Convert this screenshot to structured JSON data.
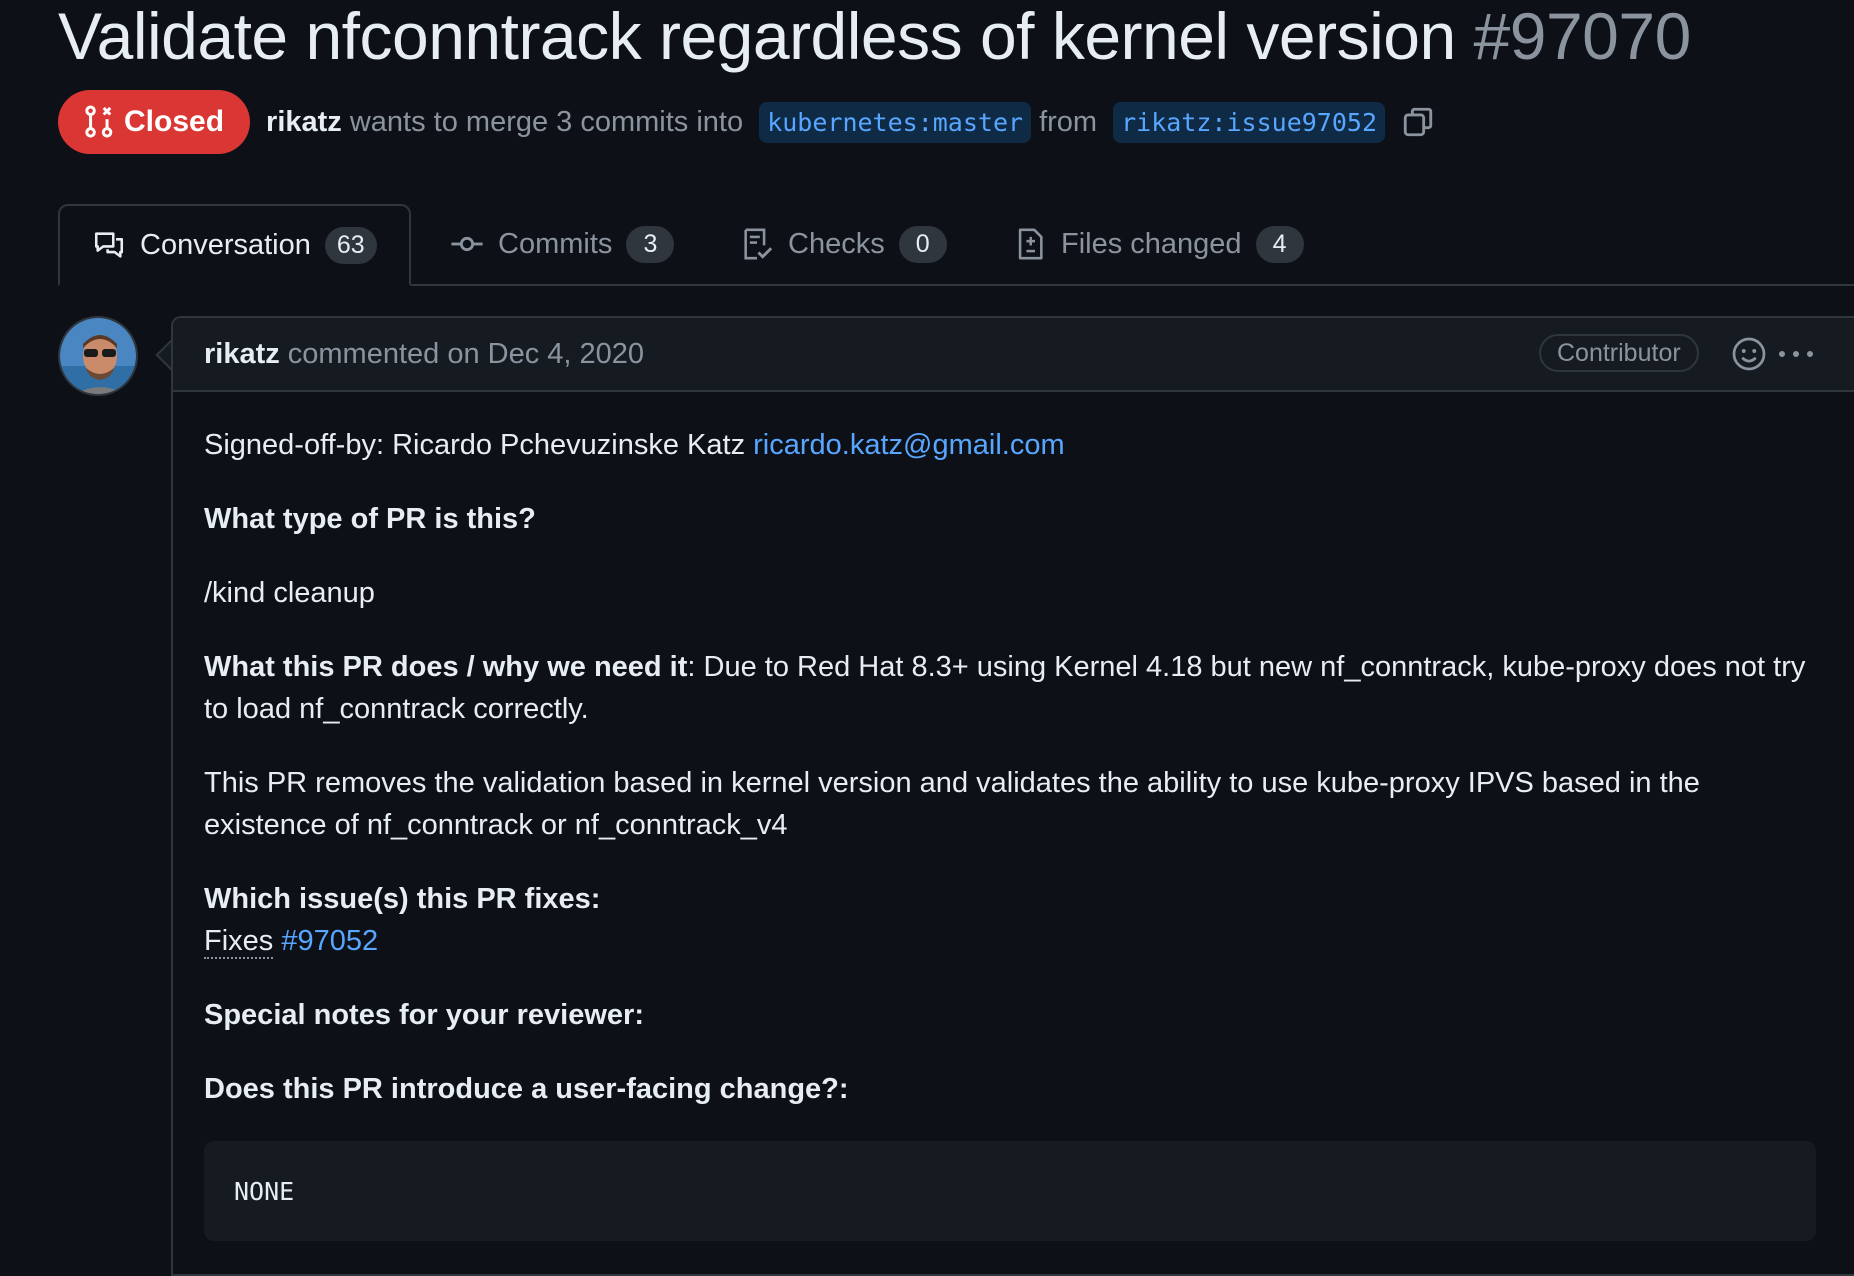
{
  "pr": {
    "title": "Validate nfconntrack regardless of kernel version",
    "number": "#97070",
    "state": "Closed",
    "author": "rikatz",
    "merge_text": "wants to merge 3 commits into",
    "base_branch": "kubernetes:master",
    "from_text": "from",
    "head_branch": "rikatz:issue97052"
  },
  "tabs": [
    {
      "label": "Conversation",
      "count": "63",
      "icon": "comment-discussion-icon"
    },
    {
      "label": "Commits",
      "count": "3",
      "icon": "git-commit-icon"
    },
    {
      "label": "Checks",
      "count": "0",
      "icon": "checklist-icon"
    },
    {
      "label": "Files changed",
      "count": "4",
      "icon": "file-diff-icon"
    }
  ],
  "comment": {
    "author": "rikatz",
    "action": "commented on Dec 4, 2020",
    "role": "Contributor",
    "signed_off_prefix": "Signed-off-by: Ricardo Pchevuzinske Katz",
    "email": "ricardo.katz@gmail.com",
    "q1": "What type of PR is this?",
    "kind": "/kind cleanup",
    "q2": "What this PR does / why we need it",
    "q2_rest": ": Due to Red Hat 8.3+ using Kernel 4.18 but new nf_conntrack, kube-proxy does not try",
    "q2_line2": "to load nf_conntrack correctly.",
    "p3_line1": "This PR removes the validation based in kernel version and validates the ability to use kube-proxy IPVS based in the",
    "p3_line2": "existence of nf_conntrack or nf_conntrack_v4",
    "q3": "Which issue(s) this PR fixes:",
    "fixes_word": "Fixes",
    "fixes_issue": "#97052",
    "q4": "Special notes for your reviewer:",
    "q5": "Does this PR introduce a user-facing change?:",
    "code": "NONE"
  },
  "colors": {
    "background": "#0d1117",
    "closed_badge": "#da3633",
    "link": "#58a6ff",
    "muted": "#8b949e"
  }
}
